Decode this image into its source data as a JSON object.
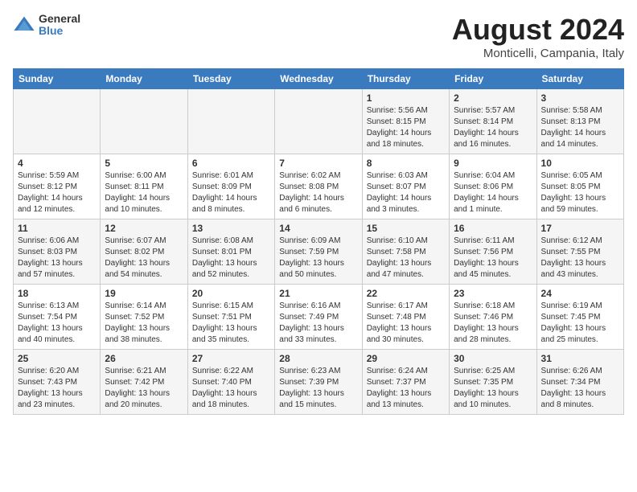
{
  "header": {
    "title": "August 2024",
    "subtitle": "Monticelli, Campania, Italy",
    "logo_general": "General",
    "logo_blue": "Blue"
  },
  "days_of_week": [
    "Sunday",
    "Monday",
    "Tuesday",
    "Wednesday",
    "Thursday",
    "Friday",
    "Saturday"
  ],
  "weeks": [
    {
      "days": [
        {
          "date": "",
          "info": ""
        },
        {
          "date": "",
          "info": ""
        },
        {
          "date": "",
          "info": ""
        },
        {
          "date": "",
          "info": ""
        },
        {
          "date": "1",
          "info": "Sunrise: 5:56 AM\nSunset: 8:15 PM\nDaylight: 14 hours\nand 18 minutes."
        },
        {
          "date": "2",
          "info": "Sunrise: 5:57 AM\nSunset: 8:14 PM\nDaylight: 14 hours\nand 16 minutes."
        },
        {
          "date": "3",
          "info": "Sunrise: 5:58 AM\nSunset: 8:13 PM\nDaylight: 14 hours\nand 14 minutes."
        }
      ]
    },
    {
      "days": [
        {
          "date": "4",
          "info": "Sunrise: 5:59 AM\nSunset: 8:12 PM\nDaylight: 14 hours\nand 12 minutes."
        },
        {
          "date": "5",
          "info": "Sunrise: 6:00 AM\nSunset: 8:11 PM\nDaylight: 14 hours\nand 10 minutes."
        },
        {
          "date": "6",
          "info": "Sunrise: 6:01 AM\nSunset: 8:09 PM\nDaylight: 14 hours\nand 8 minutes."
        },
        {
          "date": "7",
          "info": "Sunrise: 6:02 AM\nSunset: 8:08 PM\nDaylight: 14 hours\nand 6 minutes."
        },
        {
          "date": "8",
          "info": "Sunrise: 6:03 AM\nSunset: 8:07 PM\nDaylight: 14 hours\nand 3 minutes."
        },
        {
          "date": "9",
          "info": "Sunrise: 6:04 AM\nSunset: 8:06 PM\nDaylight: 14 hours\nand 1 minute."
        },
        {
          "date": "10",
          "info": "Sunrise: 6:05 AM\nSunset: 8:05 PM\nDaylight: 13 hours\nand 59 minutes."
        }
      ]
    },
    {
      "days": [
        {
          "date": "11",
          "info": "Sunrise: 6:06 AM\nSunset: 8:03 PM\nDaylight: 13 hours\nand 57 minutes."
        },
        {
          "date": "12",
          "info": "Sunrise: 6:07 AM\nSunset: 8:02 PM\nDaylight: 13 hours\nand 54 minutes."
        },
        {
          "date": "13",
          "info": "Sunrise: 6:08 AM\nSunset: 8:01 PM\nDaylight: 13 hours\nand 52 minutes."
        },
        {
          "date": "14",
          "info": "Sunrise: 6:09 AM\nSunset: 7:59 PM\nDaylight: 13 hours\nand 50 minutes."
        },
        {
          "date": "15",
          "info": "Sunrise: 6:10 AM\nSunset: 7:58 PM\nDaylight: 13 hours\nand 47 minutes."
        },
        {
          "date": "16",
          "info": "Sunrise: 6:11 AM\nSunset: 7:56 PM\nDaylight: 13 hours\nand 45 minutes."
        },
        {
          "date": "17",
          "info": "Sunrise: 6:12 AM\nSunset: 7:55 PM\nDaylight: 13 hours\nand 43 minutes."
        }
      ]
    },
    {
      "days": [
        {
          "date": "18",
          "info": "Sunrise: 6:13 AM\nSunset: 7:54 PM\nDaylight: 13 hours\nand 40 minutes."
        },
        {
          "date": "19",
          "info": "Sunrise: 6:14 AM\nSunset: 7:52 PM\nDaylight: 13 hours\nand 38 minutes."
        },
        {
          "date": "20",
          "info": "Sunrise: 6:15 AM\nSunset: 7:51 PM\nDaylight: 13 hours\nand 35 minutes."
        },
        {
          "date": "21",
          "info": "Sunrise: 6:16 AM\nSunset: 7:49 PM\nDaylight: 13 hours\nand 33 minutes."
        },
        {
          "date": "22",
          "info": "Sunrise: 6:17 AM\nSunset: 7:48 PM\nDaylight: 13 hours\nand 30 minutes."
        },
        {
          "date": "23",
          "info": "Sunrise: 6:18 AM\nSunset: 7:46 PM\nDaylight: 13 hours\nand 28 minutes."
        },
        {
          "date": "24",
          "info": "Sunrise: 6:19 AM\nSunset: 7:45 PM\nDaylight: 13 hours\nand 25 minutes."
        }
      ]
    },
    {
      "days": [
        {
          "date": "25",
          "info": "Sunrise: 6:20 AM\nSunset: 7:43 PM\nDaylight: 13 hours\nand 23 minutes."
        },
        {
          "date": "26",
          "info": "Sunrise: 6:21 AM\nSunset: 7:42 PM\nDaylight: 13 hours\nand 20 minutes."
        },
        {
          "date": "27",
          "info": "Sunrise: 6:22 AM\nSunset: 7:40 PM\nDaylight: 13 hours\nand 18 minutes."
        },
        {
          "date": "28",
          "info": "Sunrise: 6:23 AM\nSunset: 7:39 PM\nDaylight: 13 hours\nand 15 minutes."
        },
        {
          "date": "29",
          "info": "Sunrise: 6:24 AM\nSunset: 7:37 PM\nDaylight: 13 hours\nand 13 minutes."
        },
        {
          "date": "30",
          "info": "Sunrise: 6:25 AM\nSunset: 7:35 PM\nDaylight: 13 hours\nand 10 minutes."
        },
        {
          "date": "31",
          "info": "Sunrise: 6:26 AM\nSunset: 7:34 PM\nDaylight: 13 hours\nand 8 minutes."
        }
      ]
    }
  ]
}
